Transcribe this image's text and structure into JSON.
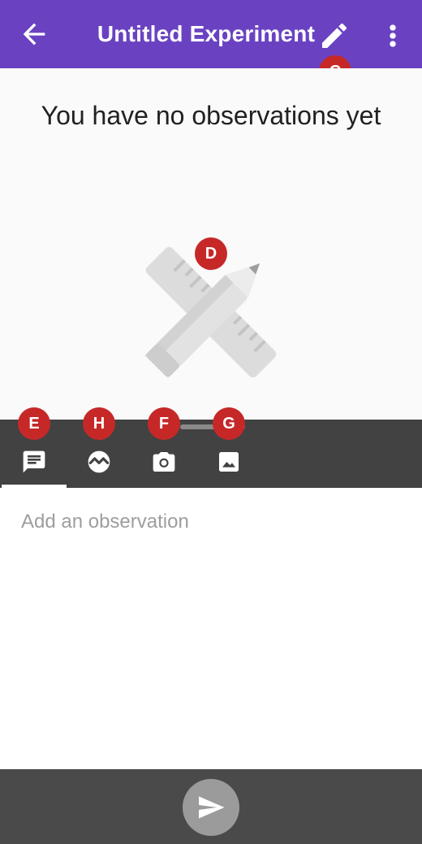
{
  "app_bar": {
    "title": "Untitled Experiment",
    "back_icon": "arrow-back-icon",
    "edit_icon": "pencil-icon",
    "menu_icon": "more-vert-icon",
    "color": "#6a42c1"
  },
  "content": {
    "empty_message": "You have no observations yet",
    "illustration": "pencil-ruler-icon"
  },
  "badges": {
    "c": "C",
    "d": "D",
    "e": "E",
    "f": "F",
    "g": "G",
    "h": "H",
    "color": "#c62828"
  },
  "toolbar": {
    "tools": [
      {
        "name": "note",
        "icon": "note-icon"
      },
      {
        "name": "sensor",
        "icon": "sensor-icon"
      },
      {
        "name": "camera",
        "icon": "camera-icon"
      },
      {
        "name": "gallery",
        "icon": "gallery-icon"
      }
    ]
  },
  "observation_input": {
    "placeholder": "Add an observation",
    "value": ""
  },
  "send_icon": "send-icon"
}
